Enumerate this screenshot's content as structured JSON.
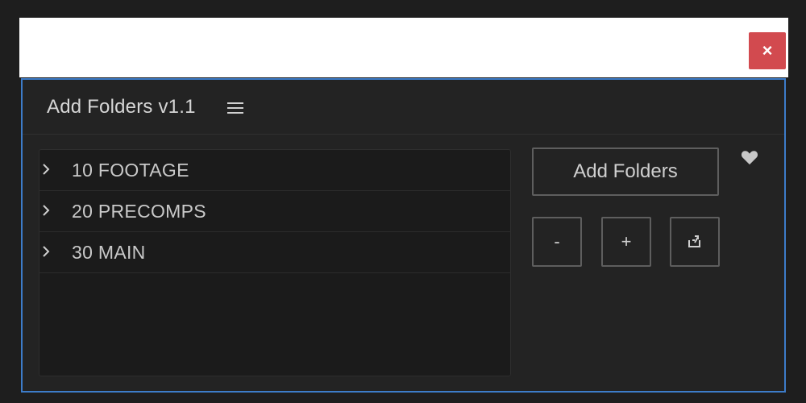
{
  "window": {
    "close_label": "×"
  },
  "panel": {
    "title": "Add Folders v1.1",
    "menu_icon": "hamburger-menu-icon"
  },
  "folders": [
    {
      "label": "10 FOOTAGE"
    },
    {
      "label": "20 PRECOMPS"
    },
    {
      "label": "30 MAIN"
    }
  ],
  "actions": {
    "add_folders_label": "Add Folders",
    "minus_label": "-",
    "plus_label": "+",
    "sync_icon": "folder-sync-icon",
    "heart_icon": "heart-icon"
  },
  "colors": {
    "panel_border": "#3d7cc9",
    "close_button": "#d24a4f",
    "background": "#1e1e1e",
    "panel_bg": "#232323"
  }
}
